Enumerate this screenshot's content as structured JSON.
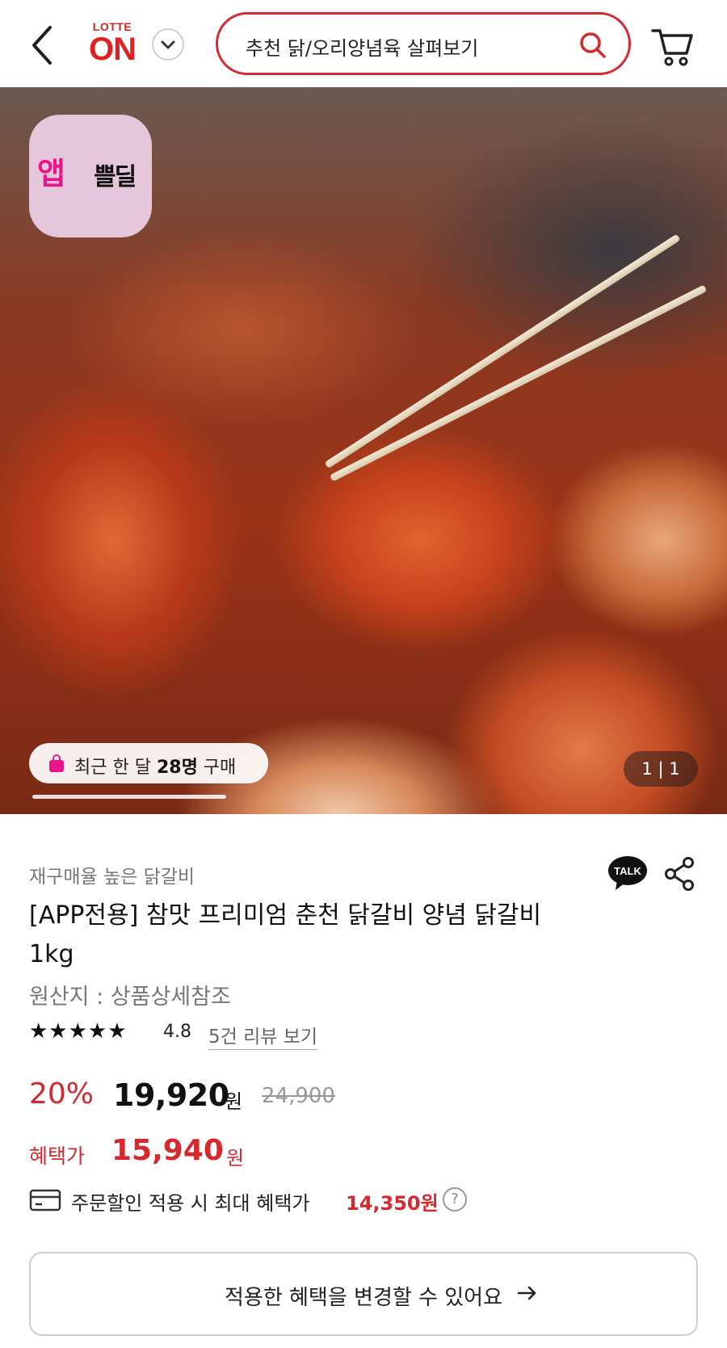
{
  "header": {
    "logo_top": "LOTTE",
    "logo_main": "ON",
    "search_placeholder": "추천 닭/오리양념육 살펴보기"
  },
  "hero": {
    "badge_text_1": "앱",
    "badge_text_2": "쁠딜",
    "purchase_prefix": "최근 한 달 ",
    "purchase_count": "28명",
    "purchase_suffix": " 구매",
    "page_counter": "1 | 1",
    "carousel_progress": 1.0
  },
  "product": {
    "subtitle": "재구매율 높은 닭갈비",
    "title": "[APP전용] 참맛 프리미엄 춘천 닭갈비 양념 닭갈비 1kg",
    "origin": "원산지 : 상품상세참조",
    "stars": "★★★★★",
    "rating": "4.8",
    "review_link": "5건 리뷰 보기"
  },
  "price": {
    "discount": "20%",
    "sale_price": "19,920",
    "currency": "원",
    "original_price": "24,900",
    "benefit_label": "혜택가",
    "benefit_price": "15,940",
    "coupon_text": "주문할인 적용 시 최대 혜택가",
    "coupon_price": "14,350원",
    "help_glyph": "?"
  },
  "actions": {
    "change_benefit_label": "적용한 혜택을 변경할 수 있어요",
    "talk_label": "TALK"
  },
  "colors": {
    "accent": "#d6282e",
    "brand": "#e0201e",
    "badge_pink": "#e8168a"
  }
}
